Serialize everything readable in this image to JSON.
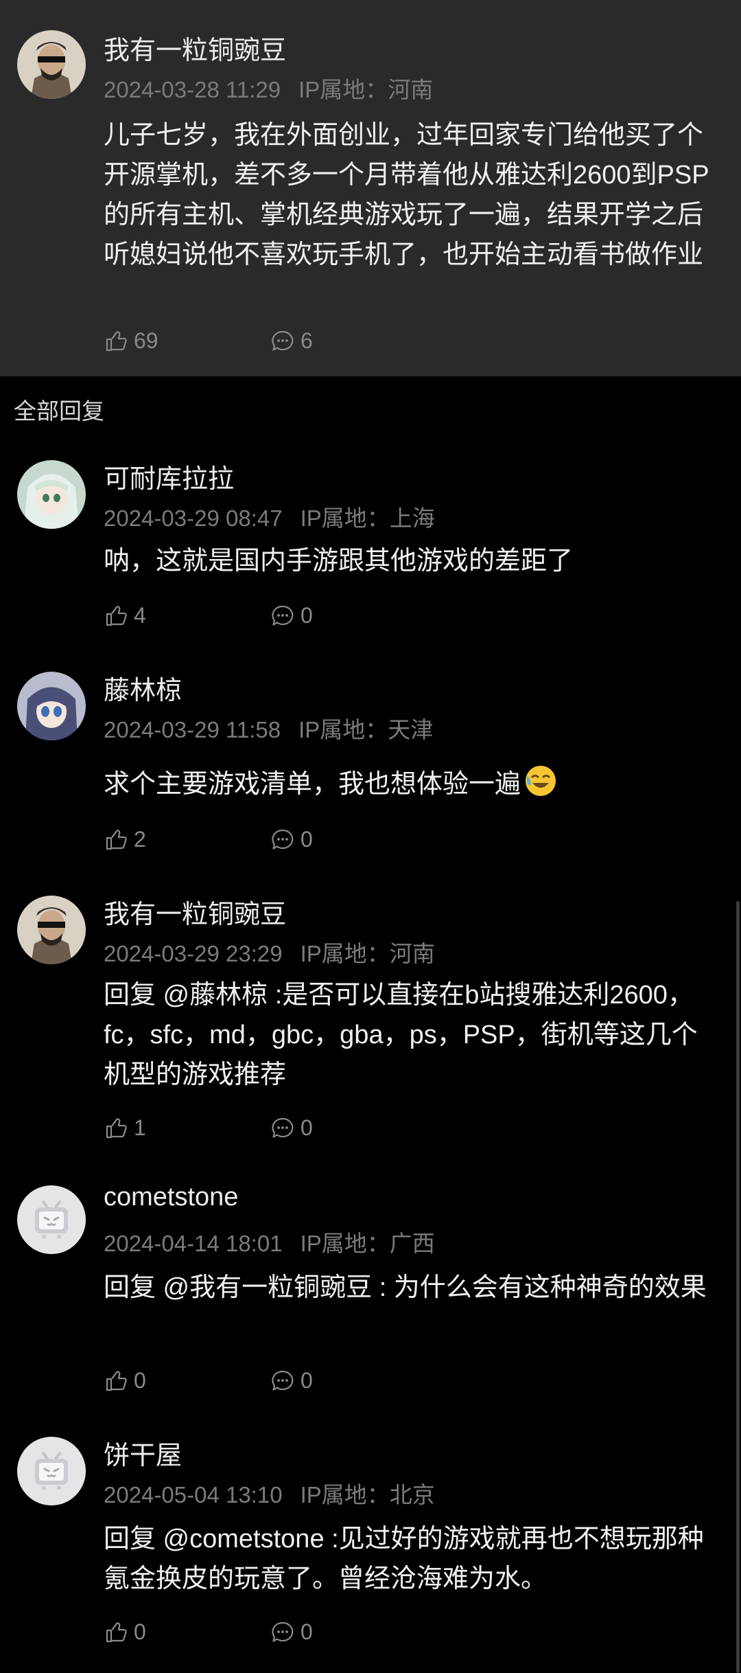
{
  "main": {
    "username": "我有一粒铜豌豆",
    "date": "2024-03-28 11:29",
    "ip": "IP属地：河南",
    "content": "儿子七岁，我在外面创业，过年回家专门给他买了个开源掌机，差不多一个月带着他从雅达利2600到PSP的所有主机、掌机经典游戏玩了一遍，结果开学之后听媳妇说他不喜欢玩手机了，也开始主动看书做作业",
    "likes": "69",
    "replies": "6"
  },
  "section_title": "全部回复",
  "comments": [
    {
      "username": "可耐库拉拉",
      "date": "2024-03-29 08:47",
      "ip": "IP属地：上海",
      "content": "呐，这就是国内手游跟其他游戏的差距了",
      "likes": "4",
      "replies": "0"
    },
    {
      "username": "藤林椋",
      "date": "2024-03-29 11:58",
      "ip": "IP属地：天津",
      "content": "求个主要游戏清单，我也想体验一遍",
      "likes": "2",
      "replies": "0"
    },
    {
      "username": "我有一粒铜豌豆",
      "date": "2024-03-29 23:29",
      "ip": "IP属地：河南",
      "content": "回复 @藤林椋 :是否可以直接在b站搜雅达利2600，fc，sfc，md，gbc，gba，ps，PSP，街机等这几个机型的游戏推荐",
      "likes": "1",
      "replies": "0"
    },
    {
      "username": "cometstone",
      "date": "2024-04-14 18:01",
      "ip": "IP属地：广西",
      "content": "回复 @我有一粒铜豌豆 : 为什么会有这种神奇的效果",
      "likes": "0",
      "replies": "0"
    },
    {
      "username": "饼干屋",
      "date": "2024-05-04 13:10",
      "ip": "IP属地：北京",
      "content": "回复 @cometstone :见过好的游戏就再也不想玩那种氪金换皮的玩意了。曾经沧海难为水。",
      "likes": "0",
      "replies": "0"
    }
  ],
  "icons": {
    "like": "thumbs-up-icon",
    "reply": "chat-bubble-icon",
    "default_avatar": "bilibili-tv-icon"
  },
  "colors": {
    "main_bg": "#2a2a2a",
    "page_bg": "#000000",
    "meta_text": "#7b7b7b"
  }
}
